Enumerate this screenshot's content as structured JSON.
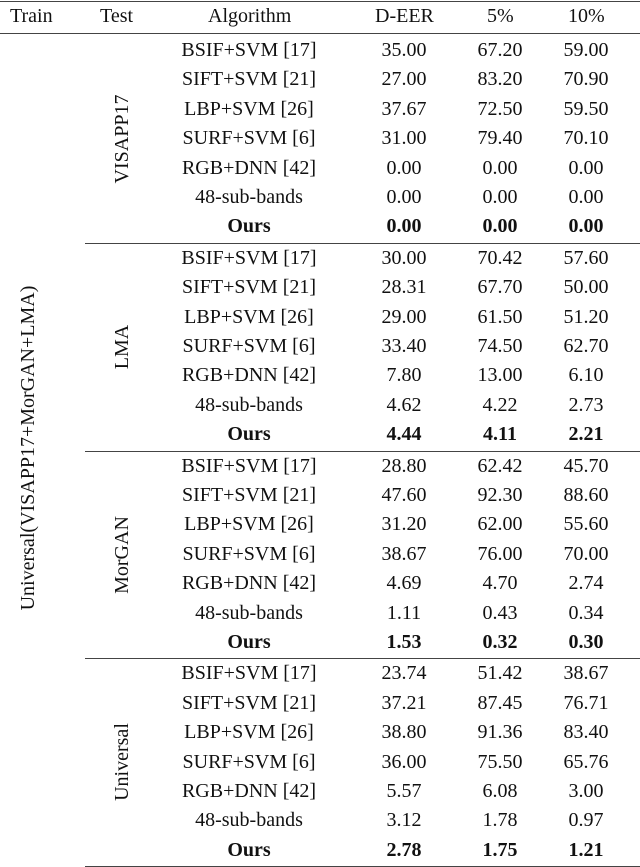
{
  "table": {
    "headers": {
      "train": "Train",
      "test": "Test",
      "algorithm": "Algorithm",
      "deer": "D-EER",
      "p5": "5%",
      "p10": "10%"
    },
    "train_label": "Universal(VISAPP17+MorGAN+LMA)",
    "sections": [
      {
        "test": "VISAPP17",
        "rows": [
          {
            "algorithm": "BSIF+SVM  [17]",
            "deer": "35.00",
            "p5": "67.20",
            "p10": "59.00"
          },
          {
            "algorithm": "SIFT+SVM  [21]",
            "deer": "27.00",
            "p5": "83.20",
            "p10": "70.90"
          },
          {
            "algorithm": "LBP+SVM  [26]",
            "deer": "37.67",
            "p5": "72.50",
            "p10": "59.50"
          },
          {
            "algorithm": "SURF+SVM  [6]",
            "deer": "31.00",
            "p5": "79.40",
            "p10": "70.10"
          },
          {
            "algorithm": "RGB+DNN  [42]",
            "deer": "0.00",
            "p5": "0.00",
            "p10": "0.00"
          },
          {
            "algorithm": "48-sub-bands",
            "deer": "0.00",
            "p5": "0.00",
            "p10": "0.00"
          },
          {
            "algorithm": "Ours",
            "deer": "0.00",
            "p5": "0.00",
            "p10": "0.00",
            "bold": true
          }
        ]
      },
      {
        "test": "LMA",
        "rows": [
          {
            "algorithm": "BSIF+SVM  [17]",
            "deer": "30.00",
            "p5": "70.42",
            "p10": "57.60"
          },
          {
            "algorithm": "SIFT+SVM  [21]",
            "deer": "28.31",
            "p5": "67.70",
            "p10": "50.00"
          },
          {
            "algorithm": "LBP+SVM  [26]",
            "deer": "29.00",
            "p5": "61.50",
            "p10": "51.20"
          },
          {
            "algorithm": "SURF+SVM  [6]",
            "deer": "33.40",
            "p5": "74.50",
            "p10": "62.70"
          },
          {
            "algorithm": "RGB+DNN  [42]",
            "deer": "7.80",
            "p5": "13.00",
            "p10": "6.10"
          },
          {
            "algorithm": "48-sub-bands",
            "deer": "4.62",
            "p5": "4.22",
            "p10": "2.73"
          },
          {
            "algorithm": "Ours",
            "deer": "4.44",
            "p5": "4.11",
            "p10": "2.21",
            "bold": true
          }
        ]
      },
      {
        "test": "MorGAN",
        "rows": [
          {
            "algorithm": "BSIF+SVM [17]",
            "deer": "28.80",
            "p5": "62.42",
            "p10": "45.70"
          },
          {
            "algorithm": "SIFT+SVM  [21]",
            "deer": "47.60",
            "p5": "92.30",
            "p10": "88.60"
          },
          {
            "algorithm": "LBP+SVM  [26]",
            "deer": "31.20",
            "p5": "62.00",
            "p10": "55.60"
          },
          {
            "algorithm": "SURF+SVM  [6]",
            "deer": "38.67",
            "p5": "76.00",
            "p10": "70.00"
          },
          {
            "algorithm": "RGB+DNN  [42]",
            "deer": "4.69",
            "p5": "4.70",
            "p10": "2.74"
          },
          {
            "algorithm": "48-sub-bands",
            "deer": "1.11",
            "p5": "0.43",
            "p10": "0.34"
          },
          {
            "algorithm": "Ours",
            "deer": "1.53",
            "p5": "0.32",
            "p10": "0.30",
            "bold": true
          }
        ]
      },
      {
        "test": "Universal",
        "rows": [
          {
            "algorithm": "BSIF+SVM  [17]",
            "deer": "23.74",
            "p5": "51.42",
            "p10": "38.67"
          },
          {
            "algorithm": "SIFT+SVM  [21]",
            "deer": "37.21",
            "p5": "87.45",
            "p10": "76.71"
          },
          {
            "algorithm": "LBP+SVM  [26]",
            "deer": "38.80",
            "p5": "91.36",
            "p10": "83.40"
          },
          {
            "algorithm": "SURF+SVM  [6]",
            "deer": "36.00",
            "p5": "75.50",
            "p10": "65.76"
          },
          {
            "algorithm": "RGB+DNN  [42]",
            "deer": "5.57",
            "p5": "6.08",
            "p10": "3.00"
          },
          {
            "algorithm": "48-sub-bands",
            "deer": "3.12",
            "p5": "1.78",
            "p10": "0.97"
          },
          {
            "algorithm": "Ours",
            "deer": "2.78",
            "p5": "1.75",
            "p10": "1.21",
            "bold": true
          }
        ]
      }
    ]
  }
}
